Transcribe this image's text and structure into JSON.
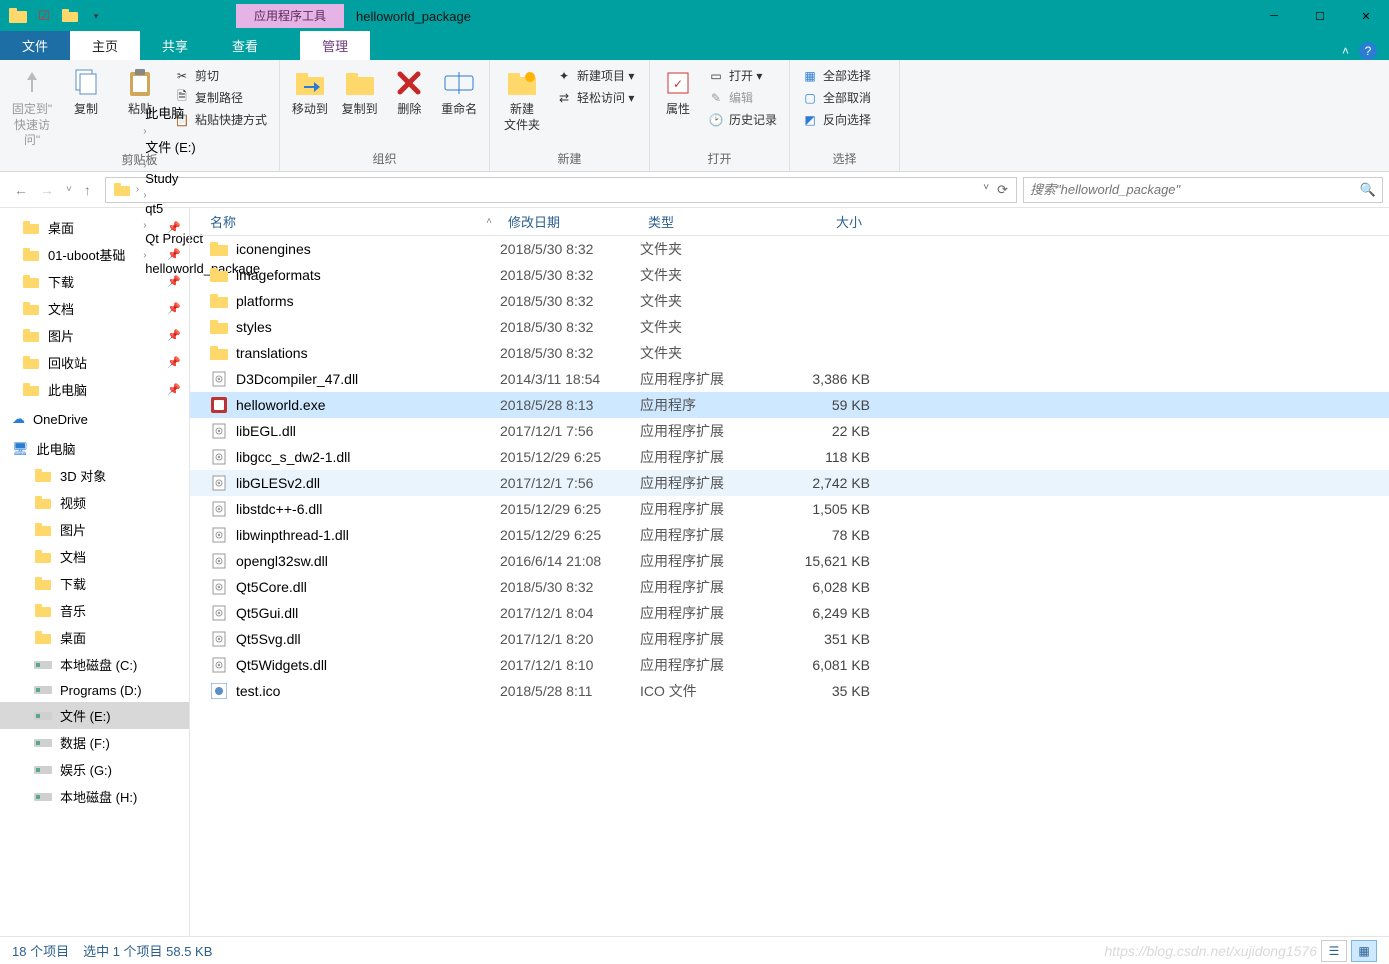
{
  "title_context_tab": "应用程序工具",
  "window_title": "helloworld_package",
  "ribbon_tabs": {
    "file": "文件",
    "home": "主页",
    "share": "共享",
    "view": "查看",
    "context": "管理"
  },
  "ribbon": {
    "clipboard": {
      "label": "剪贴板",
      "pin_quick": "固定到\"\n快速访问\"",
      "copy": "复制",
      "paste": "粘贴",
      "cut": "剪切",
      "copy_path": "复制路径",
      "paste_shortcut": "粘贴快捷方式"
    },
    "organize": {
      "label": "组织",
      "move_to": "移动到",
      "copy_to": "复制到",
      "delete": "删除",
      "rename": "重命名"
    },
    "new": {
      "label": "新建",
      "new_folder": "新建\n文件夹",
      "new_item": "新建项目 ▾",
      "easy_access": "轻松访问 ▾"
    },
    "open": {
      "label": "打开",
      "properties": "属性",
      "open": "打开 ▾",
      "edit": "编辑",
      "history": "历史记录"
    },
    "select": {
      "label": "选择",
      "select_all": "全部选择",
      "select_none": "全部取消",
      "invert": "反向选择"
    }
  },
  "breadcrumbs": [
    "此电脑",
    "文件 (E:)",
    "Study",
    "qt5",
    "Qt Project",
    "helloworld_package"
  ],
  "search_placeholder": "搜索\"helloworld_package\"",
  "navpane": {
    "quick": [
      {
        "label": "桌面",
        "pin": true,
        "icon": "folder-blue"
      },
      {
        "label": "01-uboot基础",
        "pin": true,
        "icon": "folder-yellow"
      },
      {
        "label": "下载",
        "pin": true,
        "icon": "folder-blue"
      },
      {
        "label": "文档",
        "pin": true,
        "icon": "doc"
      },
      {
        "label": "图片",
        "pin": true,
        "icon": "folder-blue"
      },
      {
        "label": "回收站",
        "pin": true,
        "icon": "bin"
      },
      {
        "label": "此电脑",
        "pin": true,
        "icon": "pc"
      }
    ],
    "onedrive": "OneDrive",
    "thispc_label": "此电脑",
    "thispc": [
      {
        "label": "3D 对象",
        "icon": "cube"
      },
      {
        "label": "视频",
        "icon": "video"
      },
      {
        "label": "图片",
        "icon": "pic"
      },
      {
        "label": "文档",
        "icon": "doc"
      },
      {
        "label": "下载",
        "icon": "dl"
      },
      {
        "label": "音乐",
        "icon": "music"
      },
      {
        "label": "桌面",
        "icon": "desk"
      },
      {
        "label": "本地磁盘 (C:)",
        "icon": "drive-win"
      },
      {
        "label": "Programs (D:)",
        "icon": "drive"
      },
      {
        "label": "文件 (E:)",
        "icon": "drive",
        "selected": true
      },
      {
        "label": "数据 (F:)",
        "icon": "drive"
      },
      {
        "label": "娱乐 (G:)",
        "icon": "drive"
      },
      {
        "label": "本地磁盘 (H:)",
        "icon": "drive"
      }
    ]
  },
  "columns": {
    "name": "名称",
    "date": "修改日期",
    "type": "类型",
    "size": "大小"
  },
  "files": [
    {
      "name": "iconengines",
      "date": "2018/5/30 8:32",
      "type": "文件夹",
      "size": "",
      "icon": "folder"
    },
    {
      "name": "imageformats",
      "date": "2018/5/30 8:32",
      "type": "文件夹",
      "size": "",
      "icon": "folder"
    },
    {
      "name": "platforms",
      "date": "2018/5/30 8:32",
      "type": "文件夹",
      "size": "",
      "icon": "folder"
    },
    {
      "name": "styles",
      "date": "2018/5/30 8:32",
      "type": "文件夹",
      "size": "",
      "icon": "folder"
    },
    {
      "name": "translations",
      "date": "2018/5/30 8:32",
      "type": "文件夹",
      "size": "",
      "icon": "folder"
    },
    {
      "name": "D3Dcompiler_47.dll",
      "date": "2014/3/11 18:54",
      "type": "应用程序扩展",
      "size": "3,386 KB",
      "icon": "dll"
    },
    {
      "name": "helloworld.exe",
      "date": "2018/5/28 8:13",
      "type": "应用程序",
      "size": "59 KB",
      "icon": "exe",
      "selected": true
    },
    {
      "name": "libEGL.dll",
      "date": "2017/12/1 7:56",
      "type": "应用程序扩展",
      "size": "22 KB",
      "icon": "dll"
    },
    {
      "name": "libgcc_s_dw2-1.dll",
      "date": "2015/12/29 6:25",
      "type": "应用程序扩展",
      "size": "118 KB",
      "icon": "dll"
    },
    {
      "name": "libGLESv2.dll",
      "date": "2017/12/1 7:56",
      "type": "应用程序扩展",
      "size": "2,742 KB",
      "icon": "dll",
      "hover": true
    },
    {
      "name": "libstdc++-6.dll",
      "date": "2015/12/29 6:25",
      "type": "应用程序扩展",
      "size": "1,505 KB",
      "icon": "dll"
    },
    {
      "name": "libwinpthread-1.dll",
      "date": "2015/12/29 6:25",
      "type": "应用程序扩展",
      "size": "78 KB",
      "icon": "dll"
    },
    {
      "name": "opengl32sw.dll",
      "date": "2016/6/14 21:08",
      "type": "应用程序扩展",
      "size": "15,621 KB",
      "icon": "dll"
    },
    {
      "name": "Qt5Core.dll",
      "date": "2018/5/30 8:32",
      "type": "应用程序扩展",
      "size": "6,028 KB",
      "icon": "dll"
    },
    {
      "name": "Qt5Gui.dll",
      "date": "2017/12/1 8:04",
      "type": "应用程序扩展",
      "size": "6,249 KB",
      "icon": "dll"
    },
    {
      "name": "Qt5Svg.dll",
      "date": "2017/12/1 8:20",
      "type": "应用程序扩展",
      "size": "351 KB",
      "icon": "dll"
    },
    {
      "name": "Qt5Widgets.dll",
      "date": "2017/12/1 8:10",
      "type": "应用程序扩展",
      "size": "6,081 KB",
      "icon": "dll"
    },
    {
      "name": "test.ico",
      "date": "2018/5/28 8:11",
      "type": "ICO 文件",
      "size": "35 KB",
      "icon": "ico"
    }
  ],
  "status": {
    "items": "18 个项目",
    "selected": "选中 1 个项目  58.5 KB"
  },
  "watermark": "https://blog.csdn.net/xujidong1576"
}
